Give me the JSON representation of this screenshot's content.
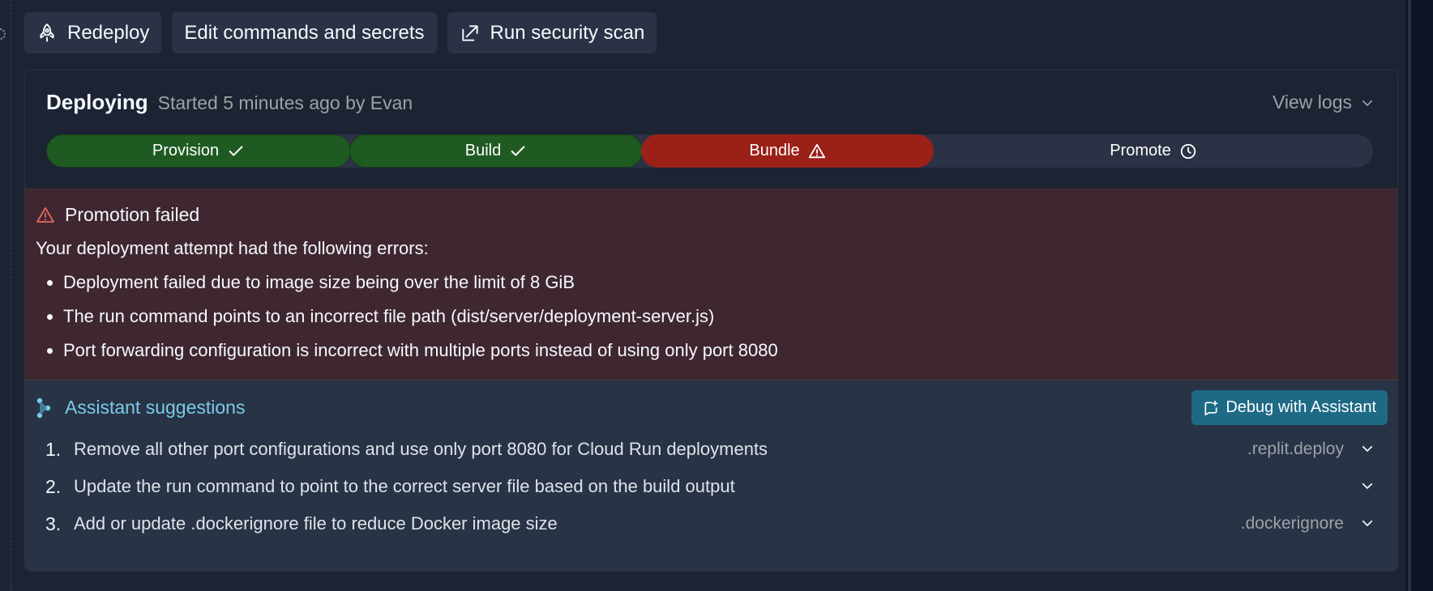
{
  "toolbar": {
    "redeploy_label": "Redeploy",
    "edit_label": "Edit commands and secrets",
    "scan_label": "Run security scan"
  },
  "status": {
    "title": "Deploying",
    "subtitle": "Started 5 minutes ago by Evan",
    "view_logs": "View logs"
  },
  "pipeline": [
    {
      "label": "Provision",
      "state": "done",
      "icon": "check-icon"
    },
    {
      "label": "Build",
      "state": "done",
      "icon": "check-icon"
    },
    {
      "label": "Bundle",
      "state": "failed",
      "icon": "warning-icon"
    },
    {
      "label": "Promote",
      "state": "pending",
      "icon": "clock-icon"
    }
  ],
  "error": {
    "title": "Promotion failed",
    "intro": "Your deployment attempt had the following errors:",
    "items": [
      "Deployment failed due to image size being over the limit of 8 GiB",
      "The run command points to an incorrect file path (dist/server/deployment-server.js)",
      "Port forwarding configuration is incorrect with multiple ports instead of using only port 8080"
    ]
  },
  "assistant": {
    "title": "Assistant suggestions",
    "debug_label": "Debug with Assistant",
    "suggestions": [
      {
        "num": "1.",
        "text": "Remove all other port configurations and use only port 8080 for Cloud Run deployments",
        "file": ".replit.deploy"
      },
      {
        "num": "2.",
        "text": "Update the run command to point to the correct server file based on the build output",
        "file": ""
      },
      {
        "num": "3.",
        "text": "Add or update .dockerignore file to reduce Docker image size",
        "file": ".dockerignore"
      }
    ]
  },
  "colors": {
    "background": "#1c2333",
    "done": "#1f5a22",
    "failed": "#9b2018",
    "error_bg": "#3f2731",
    "assistant_bg": "#283346",
    "assistant_accent": "#7bcbe8",
    "debug_button": "#1e6a86"
  }
}
